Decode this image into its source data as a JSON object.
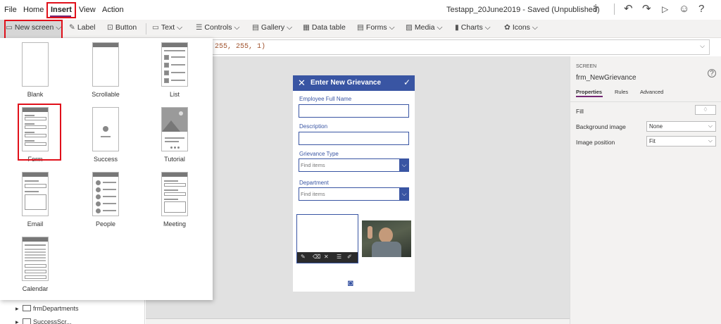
{
  "menu": {
    "file": "File",
    "home": "Home",
    "insert": "Insert",
    "view": "View",
    "action": "Action"
  },
  "app_title": "Testapp_20June2019 - Saved (Unpublished)",
  "toolbar": {
    "new_screen": "New screen",
    "label": "Label",
    "button": "Button",
    "text": "Text",
    "controls": "Controls",
    "gallery": "Gallery",
    "data_table": "Data table",
    "forms": "Forms",
    "media": "Media",
    "charts": "Charts",
    "icons": "Icons"
  },
  "formula": {
    "value": "255, 255, 1)"
  },
  "templates": [
    "Blank",
    "Scrollable",
    "List",
    "Form",
    "Success",
    "Tutorial",
    "Email",
    "People",
    "Meeting",
    "Calendar"
  ],
  "tree": {
    "item1": "frmDepartments",
    "item2": "SuccessScr..."
  },
  "phone": {
    "title": "Enter New Grievance",
    "field1": "Employee Full Name",
    "field2": "Description",
    "field3": "Grievance Type",
    "field3_placeholder": "Find items",
    "field4": "Department",
    "field4_placeholder": "Find items"
  },
  "props": {
    "section": "SCREEN",
    "screen_name": "frm_NewGrievance",
    "tabs": [
      "Properties",
      "Rules",
      "Advanced"
    ],
    "fill_label": "Fill",
    "background_image_label": "Background image",
    "background_image_value": "None",
    "image_position_label": "Image position",
    "image_position_value": "Fit"
  },
  "colors": {
    "accent": "#742774",
    "phone_header": "#3955a3",
    "highlight": "#e0101a"
  }
}
